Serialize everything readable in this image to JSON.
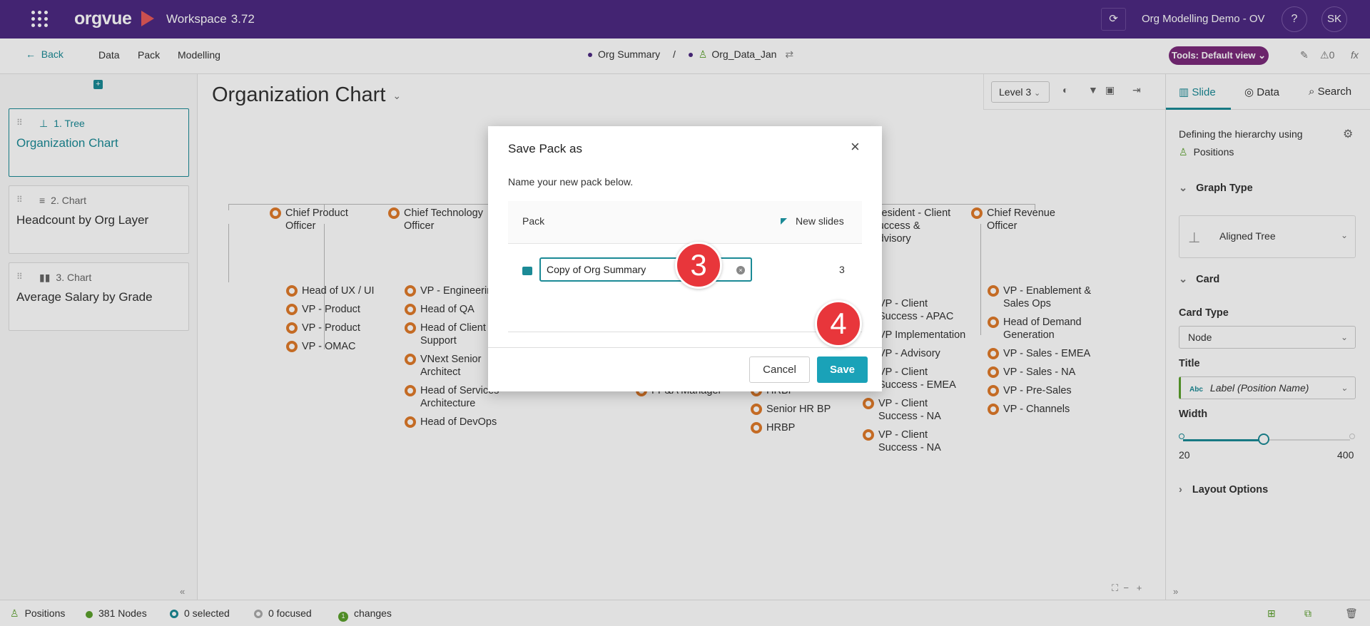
{
  "app": {
    "logo": "orgvue",
    "workspace": "Workspace",
    "version": "3.72",
    "org_name": "Org Modelling Demo - OV",
    "help": "?",
    "user_initials": "SK",
    "brand_color": "#4d2a82",
    "accent_color": "#1b8a96"
  },
  "subbar": {
    "back": "Back",
    "menu": [
      "Data",
      "Pack",
      "Modelling"
    ],
    "crumb_pack": "Org Summary",
    "crumb_sep": "/",
    "crumb_data": "Org_Data_Jan",
    "tools": "Tools: Default view",
    "alerts": "0",
    "fx": "fx"
  },
  "slides": [
    {
      "kind": "1. Tree",
      "title": "Organization Chart",
      "icon": "tree-icon"
    },
    {
      "kind": "2. Chart",
      "title": "Headcount by Org Layer",
      "icon": "bar-chart-horizontal-icon"
    },
    {
      "kind": "3. Chart",
      "title": "Average Salary by Grade",
      "icon": "bar-chart-icon"
    }
  ],
  "canvas": {
    "title": "Organization Chart",
    "level": "Level 3",
    "nodes": {
      "cpo": "Chief Product Officer",
      "cpo_children": [
        "Head of UX / UI",
        "VP - Product",
        "VP - Product",
        "VP - OMAC"
      ],
      "cto": "Chief Technology Officer",
      "cto_children": [
        "VP - Engineering",
        "Head of QA",
        "Head of Client Support",
        "VNext Senior Architect",
        "Head of Services Architecture",
        "Head of DevOps"
      ],
      "fpa": "FP&A Manager",
      "hr_children": [
        "HRBP",
        "Senior HR BP",
        "HRBP"
      ],
      "cs": "President - Client Success & Advisory",
      "cs_children": [
        "VP - Client Success - APAC",
        "VP Implementation",
        "VP - Advisory",
        "VP - Client Success - EMEA",
        "VP - Client Success - NA",
        "VP - Client Success - NA"
      ],
      "cro": "Chief Revenue Officer",
      "cro_children": [
        "VP - Enablement & Sales Ops",
        "Head of Demand Generation",
        "VP - Sales - EMEA",
        "VP - Sales - NA",
        "VP - Pre-Sales",
        "VP - Channels"
      ]
    }
  },
  "right_panel": {
    "tabs": [
      "Slide",
      "Data",
      "Search"
    ],
    "hierarchy_label": "Defining the hierarchy using",
    "hierarchy_value": "Positions",
    "graph_type_head": "Graph Type",
    "graph_type": "Aligned Tree",
    "card_head": "Card",
    "card_type_label": "Card Type",
    "card_type": "Node",
    "title_label": "Title",
    "title_badge": "Abc",
    "title_value": "Label (Position Name)",
    "width_label": "Width",
    "width_min": "20",
    "width_max": "400",
    "width_value_fraction": 0.48,
    "layout_options": "Layout Options"
  },
  "status": {
    "positions": "Positions",
    "nodes": "381 Nodes",
    "selected": "0 selected",
    "focused": "0 focused",
    "changes_count": "1",
    "changes": "changes"
  },
  "modal": {
    "title": "Save Pack as",
    "close": "×",
    "description": "Name your new pack below.",
    "col_pack": "Pack",
    "col_new_slides": "New slides",
    "input_value": "Copy of Org Summary",
    "slide_count": "3",
    "cancel": "Cancel",
    "save": "Save"
  },
  "steps": {
    "step3": "3",
    "step4": "4"
  }
}
